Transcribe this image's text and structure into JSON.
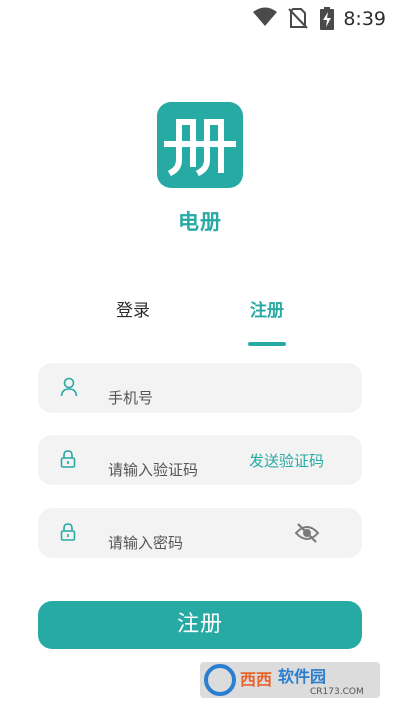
{
  "status_bar": {
    "time": "8:39",
    "icons": [
      "wifi-icon",
      "no-sim-icon",
      "battery-charging-icon"
    ]
  },
  "app": {
    "logo_glyph": "册",
    "name": "电册"
  },
  "tabs": [
    {
      "label": "登录",
      "active": false
    },
    {
      "label": "注册",
      "active": true
    }
  ],
  "form": {
    "phone": {
      "placeholder": "手机号",
      "icon": "user-icon"
    },
    "code": {
      "placeholder": "请输入验证码",
      "icon": "lock-icon",
      "send_label": "发送验证码"
    },
    "password": {
      "placeholder": "请输入密码",
      "icon": "lock-icon",
      "toggle_icon": "eye-off-icon"
    },
    "submit_label": "注册"
  },
  "watermark": {
    "brand": "西西软件园",
    "url": "CR173.COM"
  },
  "colors": {
    "accent": "#26aaa3",
    "field_bg": "#f3f3f3"
  }
}
